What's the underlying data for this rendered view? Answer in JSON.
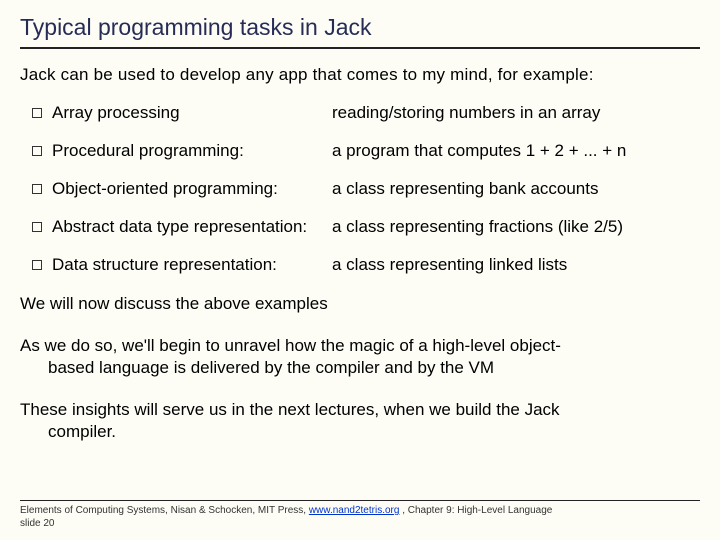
{
  "title": "Typical programming tasks in Jack",
  "intro": "Jack can be used to develop any app that comes to my mind, for example:",
  "bullets": [
    {
      "left": "Array processing",
      "right": "reading/storing numbers in an array"
    },
    {
      "left": "Procedural programming:",
      "right": "a program that computes 1 + 2 + ... + n"
    },
    {
      "left": "Object-oriented programming:",
      "right": "a class representing bank accounts"
    },
    {
      "left": "Abstract data type representation:",
      "right": "a class representing fractions (like 2/5)"
    },
    {
      "left": "Data structure representation:",
      "right": "a class representing linked lists"
    }
  ],
  "para1": "We will now discuss the above examples",
  "para2a": "As we do so, we'll begin to unravel how the magic of a high-level object-",
  "para2b": "based language is delivered by the compiler and by the VM",
  "para3a": "These insights will serve us in the next lectures, when we build the Jack",
  "para3b": "compiler.",
  "footer": {
    "prefix": "Elements of Computing Systems, Nisan & Schocken, MIT Press, ",
    "link": "www.nand2tetris.org",
    "suffix": " , Chapter 9: High-Level Language",
    "slide": "slide 20"
  }
}
